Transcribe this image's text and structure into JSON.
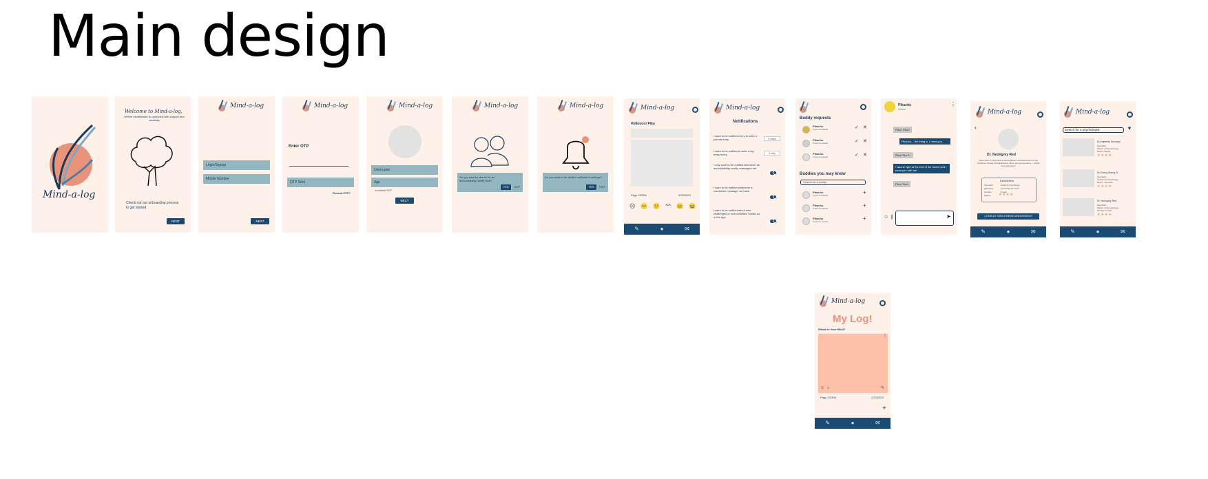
{
  "page_title": "Main design",
  "app_name": "Mind-a-log",
  "welcome": {
    "heading": "Welcome to Mind-a-log,",
    "subtitle": "Where mindfulness is combined with support and creativity.",
    "body": "Check out our onboarding process to get started",
    "next": "NEXT"
  },
  "login": {
    "login_field": "Login/Signup",
    "mobile_field": "Mobile Number",
    "next": "NEXT"
  },
  "otp": {
    "heading": "Enter OTP",
    "sent_field": "OTP Sent",
    "resend": "Resend OTP?"
  },
  "profile": {
    "username": "Username",
    "age": "Age",
    "note": "Available NOF",
    "next": "NEXT"
  },
  "buddy_prompt": {
    "question": "Do you want to search for an accountability buddy now?",
    "yes": "YES",
    "skip": "SKIP"
  },
  "notif_prompt": {
    "question": "Do you want to be alerted notification settings?",
    "yes": "YES",
    "skip": "SKIP"
  },
  "journal": {
    "greeting": "Helloooo! Pika",
    "page": "Page 23/308",
    "date": "2/20/2023",
    "moods": [
      "☹",
      "😐",
      "🙂",
      "^^",
      "😊",
      "😄"
    ]
  },
  "notifications": {
    "title": "Notifications",
    "items": [
      {
        "text": "I want to be notified every to write a journal entry.",
        "control": "2 days"
      },
      {
        "text": "I want to be notified to write a log entry every",
        "control": "1 day"
      },
      {
        "text": "I only want to be notified whenever an accountability buddy messages me.",
        "control": "toggle"
      },
      {
        "text": "I want to be notified whenever a counsellor message me back.",
        "control": "toggle"
      },
      {
        "text": "I want to be notified about new challenges or new activities I could do in the app.",
        "control": "toggle"
      }
    ]
  },
  "buddies": {
    "requests_title": "Buddy requests",
    "requests": [
      {
        "name": "Pikachu",
        "sub": "5 sent 9 mutuals"
      },
      {
        "name": "Pikachu",
        "sub": "5 sent 9 mutuals"
      },
      {
        "name": "Pikachu",
        "sub": "5 sent 9 mutuals"
      }
    ],
    "know_title": "Buddies you may know",
    "search_placeholder": "Search for a buddy",
    "suggestions": [
      {
        "name": "Pikachu",
        "sub": "5 sent 9 mutuals"
      },
      {
        "name": "Pikachu",
        "sub": "5 sent 9 mutuals"
      },
      {
        "name": "Pikachu",
        "sub": "5 sent 9 mutuals"
      }
    ]
  },
  "chat": {
    "name": "Pikachu",
    "status": "Online",
    "messages": [
      {
        "side": "l",
        "text": "Pika? Pika?"
      },
      {
        "side": "r",
        "text": "Pikachu... the thing is, I need you."
      },
      {
        "side": "l",
        "text": "Pika Pika P..."
      },
      {
        "side": "r",
        "text": "I was to fight at the end of the tunnel and I need you with me..."
      },
      {
        "side": "l",
        "text": "Pika Pika!!"
      }
    ]
  },
  "psych_profile": {
    "name": "Dr. Neongrey Red",
    "bio": "I have been on this earth to find engineers and bless them on the workforce through thoughtfulness, effort, and perseverance. -- Read more description",
    "section": "Description",
    "rows": [
      "Specialist",
      "Education",
      "Number",
      "Rating"
    ],
    "row_values": [
      "Health & Psychology",
      "University of London",
      "5 avail",
      ""
    ],
    "consult": "CONSULT WHILE BEING ANONYMOUS"
  },
  "psych_search": {
    "placeholder": "Search for a psychologist",
    "results": [
      {
        "name": "Dr.Anjeesha Kumaryn",
        "lines": "Specialist\nMaster of Neurobiology\nDoctor: PEOE"
      },
      {
        "name": "Dr.Chang Shang Ci",
        "lines": "Specialist\nAcademics Psychology\nNeuro - Ref Note"
      },
      {
        "name": "Dr. Neongrey Red",
        "lines": "Specialist\nMaster of Neurobiology\nNumber: 5 avail"
      }
    ]
  },
  "mylog": {
    "title": "My Log!",
    "prompt": "Whats in Your Mind?",
    "page": "Page 23/308",
    "date": "2/20/2023"
  },
  "colors": {
    "frame_bg": "#fdf1ea",
    "navy": "#1b4a72",
    "teal_field": "#93b6bf",
    "peach": "#e8937a",
    "log_pad": "#fcc0a8"
  }
}
